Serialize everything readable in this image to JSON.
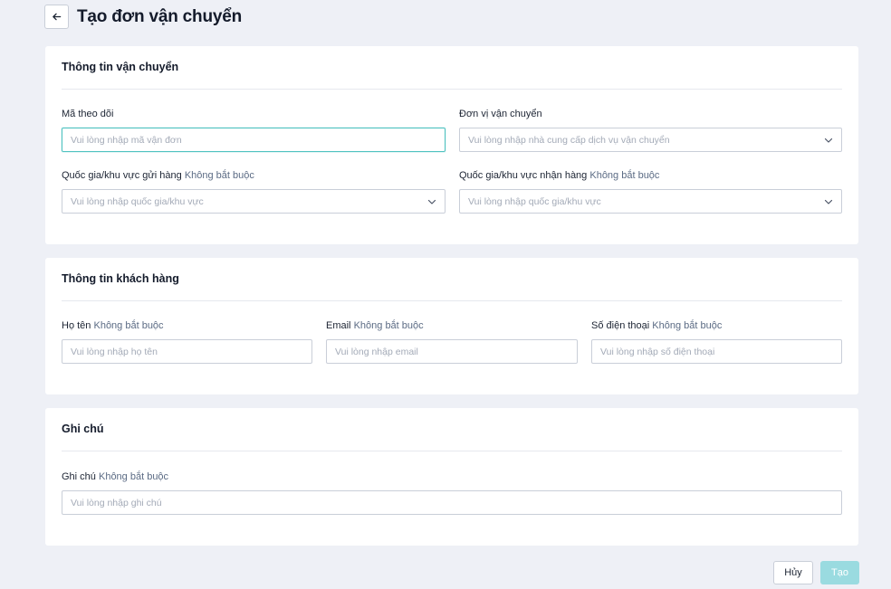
{
  "header": {
    "title": "Tạo đơn vận chuyển",
    "back_icon": "arrow-left-icon"
  },
  "shipping": {
    "title": "Thông tin vận chuyển",
    "tracking": {
      "label": "Mã theo dõi",
      "placeholder": "Vui lòng nhập mã vận đơn"
    },
    "carrier": {
      "label": "Đơn vị vận chuyển",
      "placeholder": "Vui lòng nhập nhà cung cấp dịch vụ vận chuyển"
    },
    "origin": {
      "label": "Quốc gia/khu vực gửi hàng",
      "optional": "Không bắt buộc",
      "placeholder": "Vui lòng nhập quốc gia/khu vực"
    },
    "destination": {
      "label": "Quốc gia/khu vực nhận hàng",
      "optional": "Không bắt buộc",
      "placeholder": "Vui lòng nhập quốc gia/khu vực"
    }
  },
  "customer": {
    "title": "Thông tin khách hàng",
    "name": {
      "label": "Họ tên",
      "optional": "Không bắt buộc",
      "placeholder": "Vui lòng nhập họ tên"
    },
    "email": {
      "label": "Email",
      "optional": "Không bắt buộc",
      "placeholder": "Vui lòng nhập email"
    },
    "phone": {
      "label": "Số điện thoại",
      "optional": "Không bắt buộc",
      "placeholder": "Vui lòng nhập số điện thoại"
    }
  },
  "note": {
    "title": "Ghi chú",
    "field": {
      "label": "Ghi chú",
      "optional": "Không bắt buộc",
      "placeholder": "Vui lòng nhập ghi chú"
    }
  },
  "footer": {
    "cancel_label": "Hủy",
    "create_label": "Tạo"
  },
  "colors": {
    "background": "#eef0f6",
    "focus_border": "#4fc2c0",
    "primary_disabled": "#9adbe0",
    "optional_text": "#5b6b84"
  }
}
